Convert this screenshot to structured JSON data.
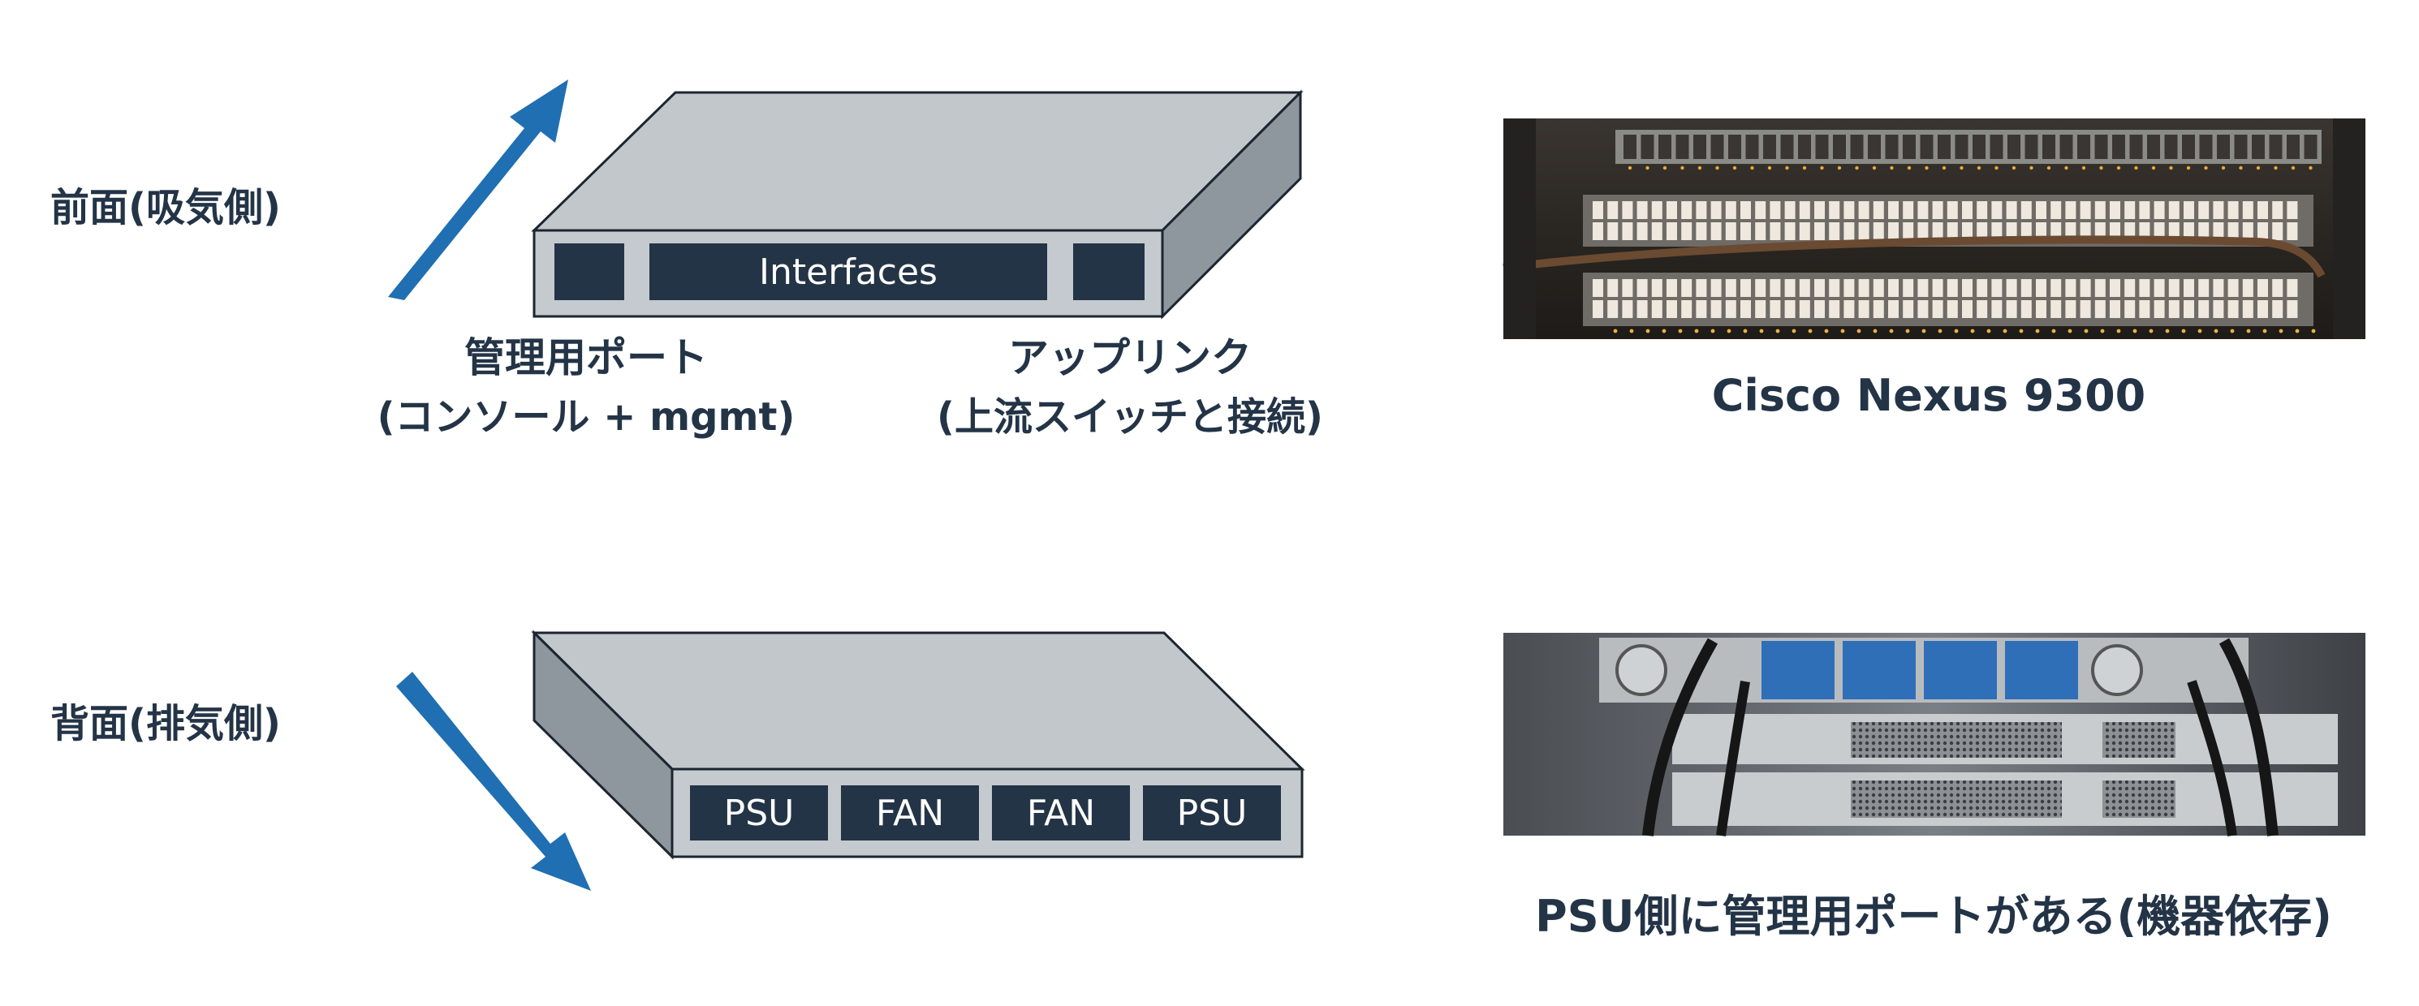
{
  "colors": {
    "arrow": "#1f6fb2",
    "switch_top": "#c2c7cc",
    "switch_front": "#c5cacf",
    "switch_side": "#8e969e",
    "port": "#243447",
    "text": "#243447",
    "outline": "#1c2630"
  },
  "front": {
    "title": "前面(吸気側)",
    "interfaces_label": "Interfaces",
    "mgmt_label_line1": "管理用ポート",
    "mgmt_label_line2": "(コンソール + mgmt)",
    "uplink_label_line1": "アップリンク",
    "uplink_label_line2": "(上流スイッチと接続)",
    "arrow_icon": "arrow-up-right-icon"
  },
  "back": {
    "title": "背面(排気側)",
    "modules": [
      "PSU",
      "FAN",
      "FAN",
      "PSU"
    ],
    "arrow_icon": "arrow-down-right-icon"
  },
  "photos": {
    "front_caption": "Cisco Nexus 9300",
    "back_caption": "PSU側に管理用ポートがある(機器依存)"
  }
}
